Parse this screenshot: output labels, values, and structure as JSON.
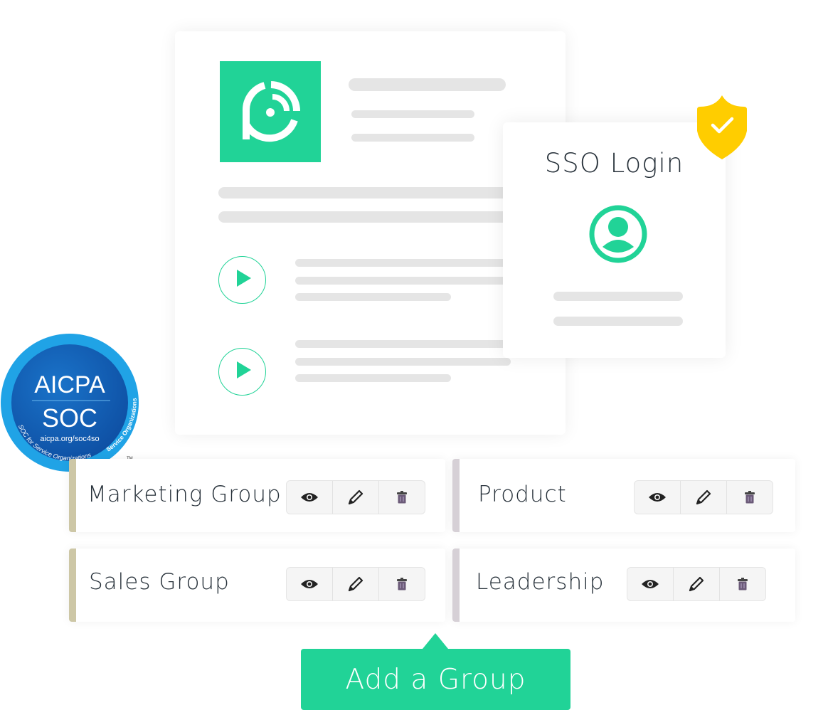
{
  "colors": {
    "brand_green": "#21d397",
    "placeholder_gray": "#e5e5e5",
    "shield_yellow": "#ffcd00",
    "soc_blue": "#1a8ed8",
    "group_accent_primary": "#cdc7a6",
    "group_accent_secondary": "#d6d0d6",
    "text_dark": "#27313a"
  },
  "main_card": {
    "logo_icon": "podcast-p-logo-icon",
    "play_items": [
      {
        "icon": "play-icon"
      },
      {
        "icon": "play-icon"
      }
    ]
  },
  "sso_card": {
    "title": "SSO Login",
    "user_icon": "user-circle-icon",
    "badge_icon": "shield-check-icon"
  },
  "soc_badge": {
    "line1": "AICPA",
    "line2": "SOC",
    "url": "aicpa.org/soc4so",
    "arc_bottom": "SOC for Service Organizations",
    "arc_right": "Service Organizations",
    "trademark": "TM"
  },
  "groups": [
    {
      "name": "Marketing Group",
      "actions": [
        "view",
        "edit",
        "delete"
      ]
    },
    {
      "name": "Product",
      "actions": [
        "view",
        "edit",
        "delete"
      ]
    },
    {
      "name": "Sales Group",
      "actions": [
        "view",
        "edit",
        "delete"
      ]
    },
    {
      "name": "Leadership",
      "actions": [
        "view",
        "edit",
        "delete"
      ]
    }
  ],
  "add_group_button": {
    "label": "Add a Group"
  }
}
